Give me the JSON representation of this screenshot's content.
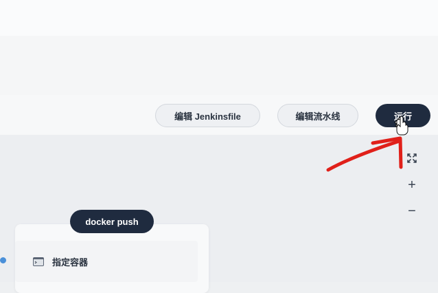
{
  "toolbar": {
    "edit_jenkinsfile_label": "编辑 Jenkinsfile",
    "edit_pipeline_label": "编辑流水线",
    "run_label": "运行"
  },
  "canvas_controls": {
    "fit_icon": "expand-arrows-icon",
    "zoom_in_label": "+",
    "zoom_out_label": "−"
  },
  "stage": {
    "name": "docker push",
    "steps": [
      {
        "label": "指定容器",
        "icon": "terminal-icon"
      }
    ]
  },
  "colors": {
    "accent_dark": "#1f2b3f",
    "annotation_red": "#e0201a",
    "connector_blue": "#4a90d9"
  }
}
